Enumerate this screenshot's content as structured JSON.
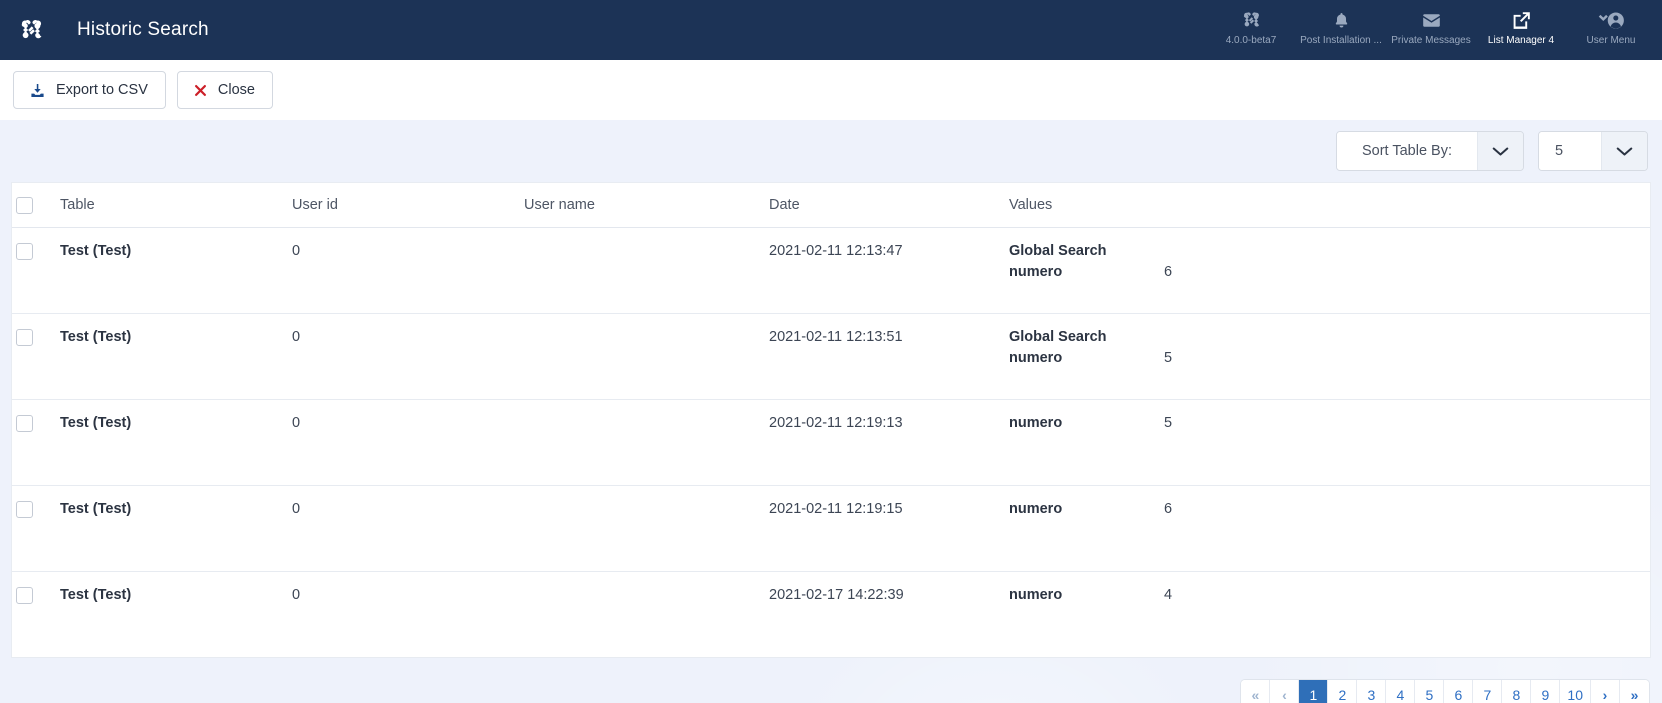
{
  "header": {
    "logo_icon": "joomla-logo-icon",
    "title": "Historic Search",
    "modules": [
      {
        "icon": "joomla-version-icon",
        "label": "4.0.0-beta7",
        "active": false
      },
      {
        "icon": "bell-icon",
        "label": "Post Installation ...",
        "active": false
      },
      {
        "icon": "envelope-icon",
        "label": "Private Messages",
        "active": false
      },
      {
        "icon": "external-link-icon",
        "label": "List Manager 4",
        "active": true
      },
      {
        "icon": "user-menu-icon",
        "label": "User Menu",
        "active": false
      }
    ]
  },
  "toolbar": {
    "export_label": "Export to CSV",
    "export_icon": "download-icon",
    "close_label": "Close",
    "close_icon": "close-x-icon"
  },
  "filters": {
    "sort": {
      "value": "Sort Table By:",
      "arrow_icon": "chevron-down-icon"
    },
    "per_page": {
      "value": "5",
      "arrow_icon": "chevron-down-icon"
    }
  },
  "table": {
    "columns": [
      "",
      "Table",
      "User id",
      "User name",
      "Date",
      "Values"
    ],
    "rows": [
      {
        "table": "Test (Test)",
        "user_id": "0",
        "user_name": "",
        "date": "2021-02-11 12:13:47",
        "values": [
          {
            "key": "Global Search",
            "value": ""
          },
          {
            "key": "numero",
            "value": "6"
          }
        ]
      },
      {
        "table": "Test (Test)",
        "user_id": "0",
        "user_name": "",
        "date": "2021-02-11 12:13:51",
        "values": [
          {
            "key": "Global Search",
            "value": ""
          },
          {
            "key": "numero",
            "value": "5"
          }
        ]
      },
      {
        "table": "Test (Test)",
        "user_id": "0",
        "user_name": "",
        "date": "2021-02-11 12:19:13",
        "values": [
          {
            "key": "numero",
            "value": "5"
          }
        ]
      },
      {
        "table": "Test (Test)",
        "user_id": "0",
        "user_name": "",
        "date": "2021-02-11 12:19:15",
        "values": [
          {
            "key": "numero",
            "value": "6"
          }
        ]
      },
      {
        "table": "Test (Test)",
        "user_id": "0",
        "user_name": "",
        "date": "2021-02-17 14:22:39",
        "values": [
          {
            "key": "numero",
            "value": "4"
          }
        ]
      }
    ]
  },
  "pagination": {
    "items": [
      {
        "label": "«",
        "name": "first-page",
        "state": "muted"
      },
      {
        "label": "‹",
        "name": "previous-page",
        "state": "muted"
      },
      {
        "label": "1",
        "name": "page-1",
        "state": "active"
      },
      {
        "label": "2",
        "name": "page-2",
        "state": "normal"
      },
      {
        "label": "3",
        "name": "page-3",
        "state": "normal"
      },
      {
        "label": "4",
        "name": "page-4",
        "state": "normal"
      },
      {
        "label": "5",
        "name": "page-5",
        "state": "normal"
      },
      {
        "label": "6",
        "name": "page-6",
        "state": "normal"
      },
      {
        "label": "7",
        "name": "page-7",
        "state": "normal"
      },
      {
        "label": "8",
        "name": "page-8",
        "state": "normal"
      },
      {
        "label": "9",
        "name": "page-9",
        "state": "normal"
      },
      {
        "label": "10",
        "name": "page-10",
        "state": "normal"
      },
      {
        "label": "›",
        "name": "next-page",
        "state": "normal"
      },
      {
        "label": "»",
        "name": "last-page",
        "state": "normal"
      }
    ]
  },
  "colors": {
    "header_bg": "#1c3356",
    "page_bg": "#eef2fb",
    "accent": "#2f6fb8",
    "danger": "#cc1f28",
    "link": "#2e6fc4"
  }
}
